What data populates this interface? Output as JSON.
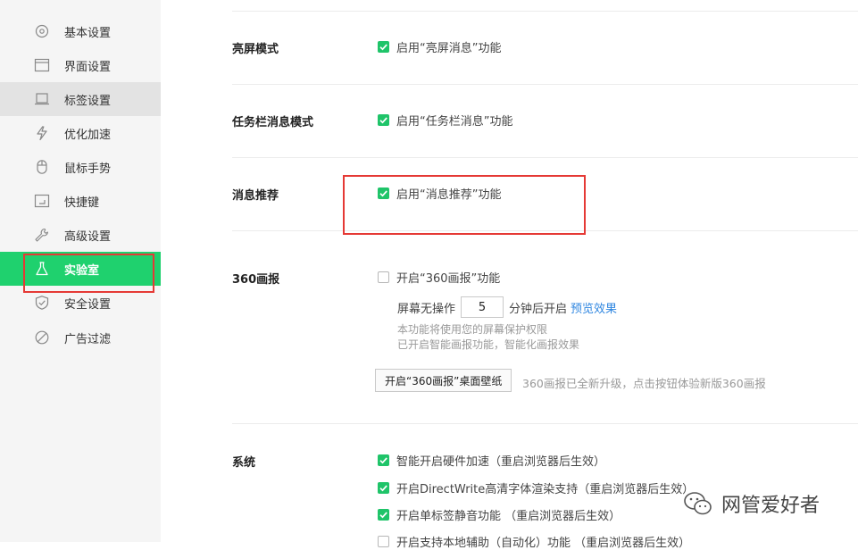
{
  "sidebar": {
    "items": [
      {
        "label": "基本设置",
        "icon": "gear-icon"
      },
      {
        "label": "界面设置",
        "icon": "window-icon"
      },
      {
        "label": "标签设置",
        "icon": "tab-icon"
      },
      {
        "label": "优化加速",
        "icon": "lightning-icon"
      },
      {
        "label": "鼠标手势",
        "icon": "mouse-icon"
      },
      {
        "label": "快捷键",
        "icon": "keyboard-icon"
      },
      {
        "label": "高级设置",
        "icon": "wrench-icon"
      },
      {
        "label": "实验室",
        "icon": "flask-icon"
      },
      {
        "label": "安全设置",
        "icon": "shield-check-icon"
      },
      {
        "label": "广告过滤",
        "icon": "ban-icon"
      }
    ],
    "active_index": 7,
    "hover_index": 2
  },
  "sections": {
    "bright": {
      "title": "亮屏模式",
      "option": "启用“亮屏消息”功能",
      "checked": true
    },
    "taskbar": {
      "title": "任务栏消息模式",
      "option": "启用“任务栏消息”功能",
      "checked": true
    },
    "recommend": {
      "title": "消息推荐",
      "option": "启用“消息推荐”功能",
      "checked": true
    },
    "pictorial": {
      "title": "360画报",
      "option": "开启“360画报”功能",
      "checked": false,
      "idle_prefix": "屏幕无操作",
      "idle_value": "5",
      "idle_suffix": "分钟后开启",
      "preview_link": "预览效果",
      "hint1": "本功能将使用您的屏幕保护权限",
      "hint2": "已开启智能画报功能，智能化画报效果",
      "wallpaper_button": "开启“360画报”桌面壁纸",
      "wallpaper_note": "360画报已全新升级，点击按钮体验新版360画报"
    },
    "system": {
      "title": "系统",
      "options": [
        {
          "label": "智能开启硬件加速（重启浏览器后生效）",
          "checked": true
        },
        {
          "label": "开启DirectWrite高清字体渲染支持（重启浏览器后生效）",
          "checked": true
        },
        {
          "label": "开启单标签静音功能 （重启浏览器后生效）",
          "checked": true
        },
        {
          "label": "开启支持本地辅助（自动化）功能 （重启浏览器后生效）",
          "checked": false
        }
      ]
    }
  },
  "watermark": {
    "text": "网管爱好者"
  },
  "colors": {
    "accent": "#1fd16e",
    "checkbox": "#1fc469",
    "highlight": "#e53935",
    "link": "#2f86e0"
  }
}
